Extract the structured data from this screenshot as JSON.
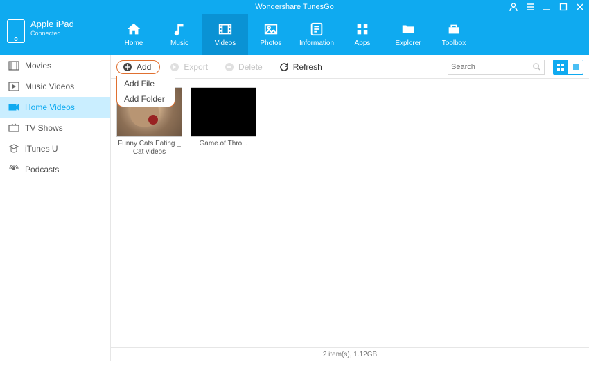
{
  "app": {
    "title": "Wondershare TunesGo"
  },
  "device": {
    "name": "Apple iPad",
    "status": "Connected"
  },
  "nav": {
    "home": "Home",
    "music": "Music",
    "videos": "Videos",
    "photos": "Photos",
    "information": "Information",
    "apps": "Apps",
    "explorer": "Explorer",
    "toolbox": "Toolbox"
  },
  "sidebar": {
    "movies": "Movies",
    "musicvideos": "Music Videos",
    "homevideos": "Home Videos",
    "tvshows": "TV Shows",
    "itunesu": "iTunes U",
    "podcasts": "Podcasts"
  },
  "toolbar": {
    "add": "Add",
    "export": "Export",
    "delete": "Delete",
    "refresh": "Refresh",
    "search_placeholder": "Search",
    "add_menu": {
      "add_file": "Add File",
      "add_folder": "Add Folder"
    }
  },
  "items": [
    {
      "title": "Funny Cats Eating _ Cat videos Compilati..."
    },
    {
      "title": "Game.of.Thro..."
    }
  ],
  "status": "2 item(s), 1.12GB"
}
